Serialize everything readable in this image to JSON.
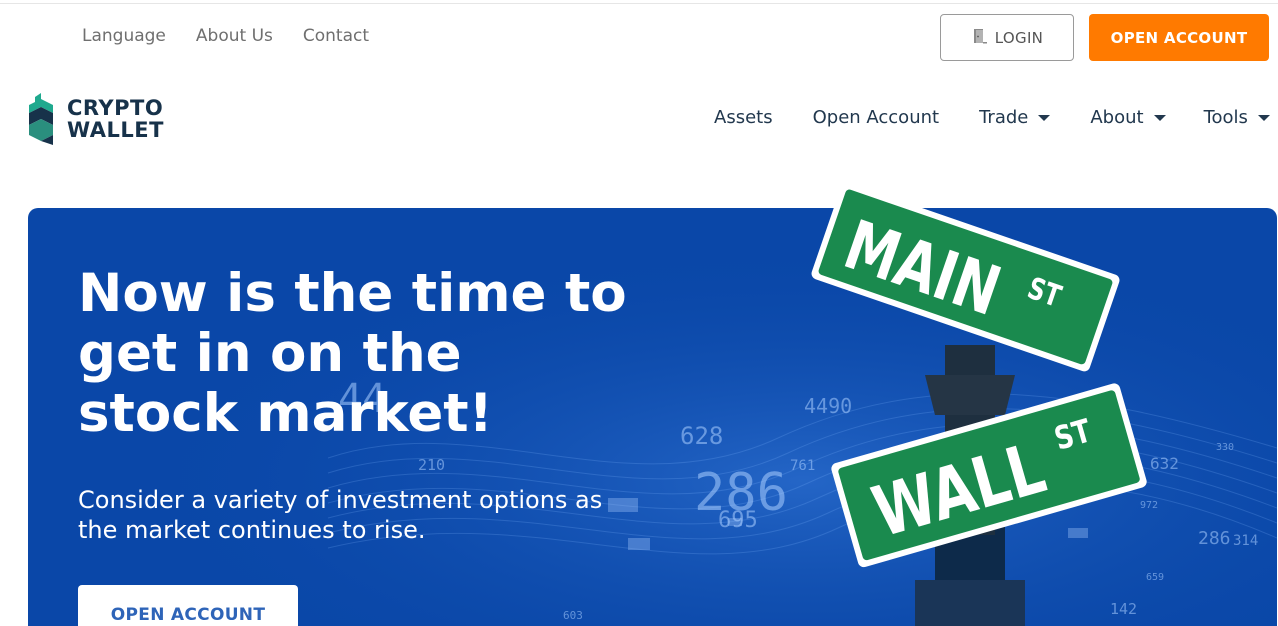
{
  "topbar": {
    "links": [
      "Language",
      "About Us",
      "Contact"
    ],
    "login_label": "LOGIN",
    "open_account_label": "OPEN ACCOUNT"
  },
  "brand": {
    "line1": "CRYPTO",
    "line2": "WALLET",
    "icon": "crypto-wallet-logo"
  },
  "nav": {
    "items": [
      {
        "label": "Assets",
        "dropdown": false
      },
      {
        "label": "Open Account",
        "dropdown": false
      },
      {
        "label": "Trade",
        "dropdown": true
      },
      {
        "label": "About",
        "dropdown": true
      },
      {
        "label": "Tools",
        "dropdown": true
      }
    ]
  },
  "hero": {
    "title": "Now is the time to get in on the stock market!",
    "subtitle": "Consider a variety of investment options as the market continues to rise.",
    "cta_label": "OPEN ACCOUNT",
    "sign_top_main": "MAIN",
    "sign_top_suffix": "ST",
    "sign_bottom_main": "WALL",
    "sign_bottom_suffix": "ST",
    "ticker_numbers": [
      "44",
      "628",
      "286",
      "695",
      "4490",
      "761",
      "632",
      "286",
      "314",
      "142",
      "210",
      "330",
      "972",
      "659",
      "603"
    ]
  },
  "colors": {
    "accent": "#ff7a00",
    "hero_bg": "#0a47a8",
    "sign_green": "#1a8a4e",
    "brand_dark": "#17324a"
  }
}
